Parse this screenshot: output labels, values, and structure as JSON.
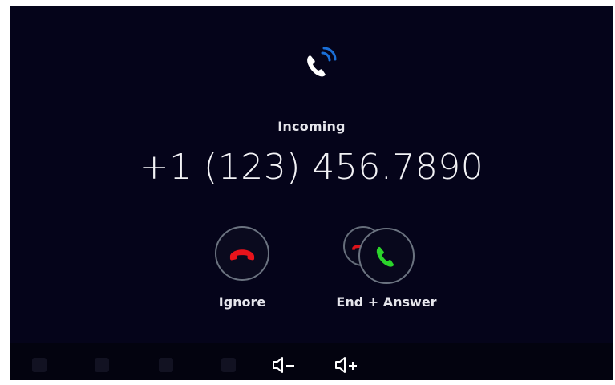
{
  "call": {
    "status_label": "Incoming",
    "phone_number": "+1 (123) 456.7890"
  },
  "actions": {
    "ignore_label": "Ignore",
    "end_answer_label": "End + Answer"
  },
  "icons": {
    "top": "incoming-call-icon",
    "ignore": "hangup-phone-icon",
    "answer": "answer-phone-icon",
    "volume_down": "volume-down-icon",
    "volume_up": "volume-up-icon"
  },
  "colors": {
    "background": "#05041a",
    "accent_blue": "#1a6fd8",
    "decline_red": "#e8131b",
    "answer_green": "#2bd42b",
    "button_border": "#6b7380",
    "text": "#f2f2f5"
  }
}
